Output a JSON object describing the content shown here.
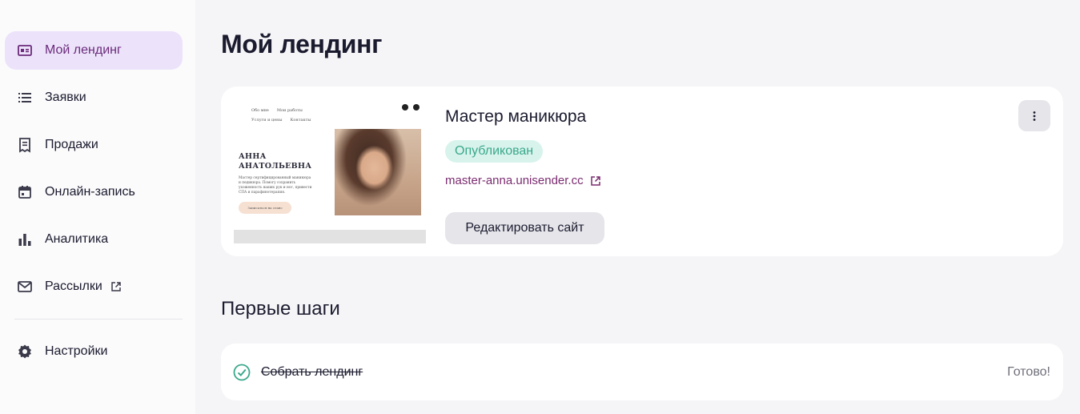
{
  "sidebar": {
    "items": [
      {
        "label": "Мой лендинг",
        "icon": "landing-icon",
        "active": true
      },
      {
        "label": "Заявки",
        "icon": "list-icon"
      },
      {
        "label": "Продажи",
        "icon": "receipt-icon"
      },
      {
        "label": "Онлайн-запись",
        "icon": "calendar-icon"
      },
      {
        "label": "Аналитика",
        "icon": "bar-chart-icon"
      },
      {
        "label": "Рассылки",
        "icon": "mail-icon",
        "external": true
      }
    ],
    "settings": {
      "label": "Настройки",
      "icon": "gear-icon"
    }
  },
  "page": {
    "title": "Мой лендинг"
  },
  "site_card": {
    "name": "Мастер маникюра",
    "status": "Опубликован",
    "url": "master-anna.unisender.cc",
    "edit_label": "Редактировать сайт",
    "preview": {
      "nav": [
        "Обо мне",
        "Мои работы",
        "Услуги и цены",
        "Контакты"
      ],
      "name_line1": "АННА",
      "name_line2": "АНАТОЛЬЕВНА",
      "description": "Мастер сертифицированный маникюра и педикюра. Помогу сохранить ухоженность ваших рук и ног, привести СПА и парафинотерапия.",
      "button": "Записаться на сеанс"
    }
  },
  "first_steps": {
    "title": "Первые шаги",
    "steps": [
      {
        "label": "Собрать лендинг",
        "status": "Готово!",
        "done": true
      }
    ]
  },
  "colors": {
    "accent": "#6b2a7a",
    "active_bg": "#ece3fb",
    "status_bg": "#d8f3ec",
    "status_fg": "#3aa88b",
    "check": "#3aa88b"
  }
}
